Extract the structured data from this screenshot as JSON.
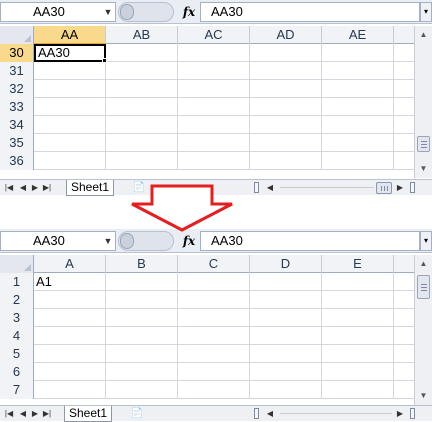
{
  "top": {
    "name_box": "AA30",
    "formula": "AA30",
    "fx": "fx",
    "columns": [
      {
        "label": "AA",
        "active": true
      },
      {
        "label": "AB",
        "active": false
      },
      {
        "label": "AC",
        "active": false
      },
      {
        "label": "AD",
        "active": false
      },
      {
        "label": "AE",
        "active": false
      }
    ],
    "rows": [
      {
        "num": "30",
        "active": true,
        "cells": [
          "AA30",
          "",
          "",
          "",
          ""
        ]
      },
      {
        "num": "31",
        "active": false,
        "cells": [
          "",
          "",
          "",
          "",
          ""
        ]
      },
      {
        "num": "32",
        "active": false,
        "cells": [
          "",
          "",
          "",
          "",
          ""
        ]
      },
      {
        "num": "33",
        "active": false,
        "cells": [
          "",
          "",
          "",
          "",
          ""
        ]
      },
      {
        "num": "34",
        "active": false,
        "cells": [
          "",
          "",
          "",
          "",
          ""
        ]
      },
      {
        "num": "35",
        "active": false,
        "cells": [
          "",
          "",
          "",
          "",
          ""
        ]
      },
      {
        "num": "36",
        "active": false,
        "cells": [
          "",
          "",
          "",
          "",
          ""
        ]
      }
    ],
    "sheet_tab": "Sheet1"
  },
  "bottom": {
    "name_box": "AA30",
    "formula": "AA30",
    "fx": "fx",
    "columns": [
      {
        "label": "A",
        "active": false
      },
      {
        "label": "B",
        "active": false
      },
      {
        "label": "C",
        "active": false
      },
      {
        "label": "D",
        "active": false
      },
      {
        "label": "E",
        "active": false
      }
    ],
    "rows": [
      {
        "num": "1",
        "active": false,
        "cells": [
          "A1",
          "",
          "",
          "",
          ""
        ]
      },
      {
        "num": "2",
        "active": false,
        "cells": [
          "",
          "",
          "",
          "",
          ""
        ]
      },
      {
        "num": "3",
        "active": false,
        "cells": [
          "",
          "",
          "",
          "",
          ""
        ]
      },
      {
        "num": "4",
        "active": false,
        "cells": [
          "",
          "",
          "",
          "",
          ""
        ]
      },
      {
        "num": "5",
        "active": false,
        "cells": [
          "",
          "",
          "",
          "",
          ""
        ]
      },
      {
        "num": "6",
        "active": false,
        "cells": [
          "",
          "",
          "",
          "",
          ""
        ]
      },
      {
        "num": "7",
        "active": false,
        "cells": [
          "",
          "",
          "",
          "",
          ""
        ]
      }
    ],
    "sheet_tab": "Sheet1"
  },
  "icons": {
    "name_box_dropdown": "chevron-down-icon",
    "insert_function": "fx-icon",
    "expand_formula_bar": "chevron-down-icon",
    "first_sheet": "first-sheet-icon",
    "prev_sheet": "prev-sheet-icon",
    "next_sheet": "next-sheet-icon",
    "last_sheet": "last-sheet-icon",
    "insert_sheet": "insert-sheet-icon",
    "transition_arrow": "down-arrow-icon"
  },
  "colors": {
    "active_header": "#f9d98c",
    "arrow_stroke": "#e31f1f",
    "header_bg": "#f1f3f6",
    "gridline": "#d4d8de"
  }
}
